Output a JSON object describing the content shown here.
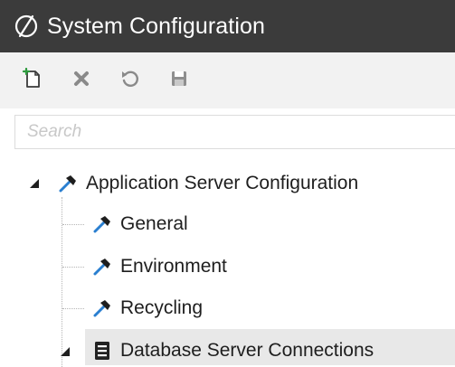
{
  "window": {
    "title": "System Configuration",
    "logo_icon": "app-logo-icon"
  },
  "toolbar": {
    "buttons": [
      {
        "name": "new-button",
        "icon": "new-document-icon"
      },
      {
        "name": "delete-button",
        "icon": "delete-x-icon"
      },
      {
        "name": "refresh-button",
        "icon": "refresh-icon"
      },
      {
        "name": "save-button",
        "icon": "save-disk-icon"
      }
    ]
  },
  "search": {
    "placeholder": "Search",
    "value": ""
  },
  "tree": {
    "root": {
      "label": "Application Server Configuration",
      "icon": "hammer-icon",
      "expanded": true
    },
    "children": [
      {
        "label": "General",
        "icon": "hammer-icon"
      },
      {
        "label": "Environment",
        "icon": "hammer-icon"
      },
      {
        "label": "Recycling",
        "icon": "hammer-icon"
      },
      {
        "label": "Database Server Connections",
        "icon": "server-icon",
        "expanded": true,
        "selected": true
      }
    ]
  },
  "colors": {
    "titlebar_bg": "#3b3b3b",
    "toolbar_bg": "#f2f2f2",
    "hammer_blue": "#2a7fd0",
    "selection_bg": "#e8e8e8"
  }
}
